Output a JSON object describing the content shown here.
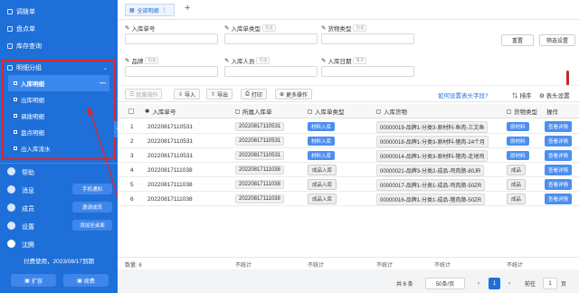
{
  "sidebar": {
    "nav_top": [
      "调拨单",
      "盘点单",
      "库存查询"
    ],
    "group_label": "明细分组",
    "group_items": [
      "入库明细",
      "出库明细",
      "调拨明细",
      "盘点明细",
      "出入库流水"
    ],
    "help": "帮助",
    "messages": "消息",
    "messages_pill": "手机通知",
    "members": "成员",
    "members_pill": "邀请成员",
    "settings": "设置",
    "settings_pill": "添加至桌面",
    "user_name": "沈腾",
    "plan_text": "付费使用，2023/08/17到期",
    "expand_button": "扩容",
    "renew_button": "续费",
    "accent": "#1f6fd8",
    "highlight": "#e0242e"
  },
  "tabs": {
    "active_label": "全部明细"
  },
  "filters": {
    "f1_label": "入库单号",
    "f2_label": "入库单类型",
    "f2_tag": "包含",
    "f3_label": "货物类型",
    "f3_tag": "包含",
    "f4_label": "品牌",
    "f4_tag": "包含",
    "f5_label": "入库人员",
    "f5_tag": "包含",
    "f6_label": "入库日期",
    "f6_tag": "等于",
    "reset": "重置",
    "filter_settings": "筛选设置"
  },
  "toolbar": {
    "batch": "批量操作",
    "import": "导入",
    "export": "导出",
    "print": "打印",
    "more": "更多操作",
    "link": "如何设置表头字段?",
    "sort": "排序",
    "header_settings": "表头设置"
  },
  "table": {
    "headers": [
      "入库单号",
      "所属入库单",
      "入库单类型",
      "入库货物",
      "货物类型",
      "操作"
    ],
    "rows": [
      {
        "num": "1",
        "order": "20220817110531",
        "parent": "20220817110531",
        "type": "材料入库",
        "goods": "00000019-品牌1-分类3-原材料-鱼肉-三文鱼",
        "gtype": "原材料",
        "action": "查看详情"
      },
      {
        "num": "2",
        "order": "20220817110531",
        "parent": "20220817110531",
        "type": "材料入库",
        "goods": "00000018-品牌1-分类3-原材料-猪肉-24个月",
        "gtype": "原材料",
        "action": "查看详情"
      },
      {
        "num": "3",
        "order": "20220817110531",
        "parent": "20220817110531",
        "type": "材料入库",
        "goods": "00000014-品牌1-分类3-原材料-猪肉-走地鸡",
        "gtype": "原材料",
        "action": "查看详情"
      },
      {
        "num": "4",
        "order": "20220817111038",
        "parent": "20220817111038",
        "type": "成品入库",
        "goods": "00000021-品牌3-分类2-成品-鸡肉肠-80JR",
        "gtype": "成品",
        "action": "查看详情"
      },
      {
        "num": "5",
        "order": "20220817111038",
        "parent": "20220817111038",
        "type": "成品入库",
        "goods": "00000017-品牌1-分类1-成品-鸡肉肠-50ZR",
        "gtype": "成品",
        "action": "查看详情"
      },
      {
        "num": "6",
        "order": "20220817111038",
        "parent": "20220817111038",
        "type": "成品入库",
        "goods": "00000016-品牌1-分类1-成品-猪肉肠-50ZR",
        "gtype": "成品",
        "action": "查看详情"
      }
    ],
    "footer_count": "数量: 6",
    "footer_stat": "不统计"
  },
  "pager": {
    "total": "共 6 条",
    "per_page": "50条/页",
    "current": "1",
    "goto_prefix": "前往",
    "goto_value": "1",
    "goto_suffix": "页"
  }
}
